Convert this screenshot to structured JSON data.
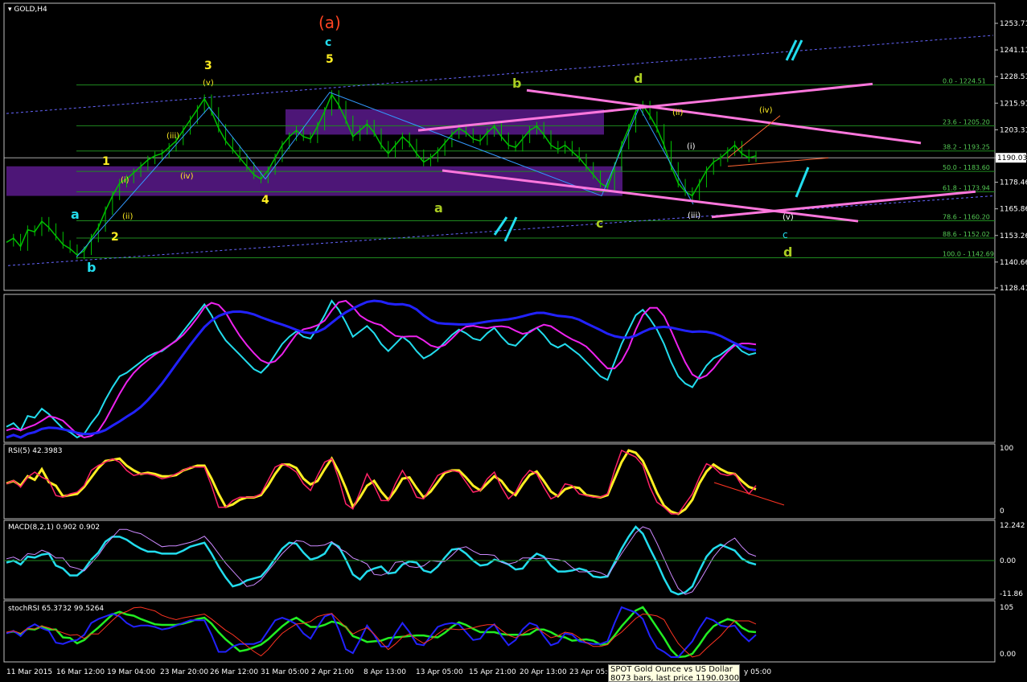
{
  "symbol_label": "GOLD,H4",
  "colors": {
    "background": "#000000",
    "grid_border": "#c0c0c0",
    "fib": "#1f8a1f",
    "candle": "#00c000",
    "zone": "#5a1a8c",
    "pink": "#ff77dd",
    "cyan": "#22ddee",
    "yellow": "#ffee22",
    "orange_red": "#ff4422",
    "blue": "#2222ff",
    "magenta": "#ee22ee"
  },
  "price_axis": {
    "ticks": [
      "1253.71",
      "1241.11",
      "1228.51",
      "1215.91",
      "1203.31",
      "1190.03",
      "1178.46",
      "1165.86",
      "1153.26",
      "1140.66",
      "1128.41"
    ],
    "current_price": "1190.03"
  },
  "chart_data": {
    "type": "line",
    "title": "GOLD,H4",
    "ylim": [
      1128.41,
      1253.71
    ],
    "fib_levels": [
      {
        "label": "0.0 - 1224.51",
        "value": 1224.51
      },
      {
        "label": "23.6 - 1205.20",
        "value": 1205.2
      },
      {
        "label": "38.2 - 1193.25",
        "value": 1193.25
      },
      {
        "label": "50.0 - 1183.60",
        "value": 1183.6
      },
      {
        "label": "61.8 - 1173.94",
        "value": 1173.94
      },
      {
        "label": "78.6 - 1160.20",
        "value": 1160.2
      },
      {
        "label": "88.6 - 1152.02",
        "value": 1152.02
      },
      {
        "label": "100.0 - 1142.69",
        "value": 1142.69
      }
    ],
    "x_ticks": [
      "11 Mar 2015",
      "16 Mar 12:00",
      "19 Mar 04:00",
      "23 Mar 20:00",
      "26 Mar 12:00",
      "31 Mar 05:00",
      "2 Apr 21:00",
      "8 Apr 13:00",
      "13 Apr 05:00",
      "15 Apr 21:00",
      "20 Apr 13:00",
      "23 Apr 05:00",
      "y 05:00"
    ],
    "close_series": [
      1150,
      1152,
      1148,
      1156,
      1155,
      1160,
      1157,
      1153,
      1149,
      1147,
      1144,
      1146,
      1152,
      1157,
      1165,
      1172,
      1178,
      1180,
      1183,
      1186,
      1189,
      1191,
      1192,
      1195,
      1198,
      1203,
      1208,
      1213,
      1218,
      1212,
      1204,
      1198,
      1194,
      1190,
      1186,
      1182,
      1180,
      1184,
      1190,
      1196,
      1200,
      1203,
      1200,
      1199,
      1205,
      1212,
      1220,
      1215,
      1208,
      1200,
      1203,
      1206,
      1202,
      1196,
      1192,
      1196,
      1200,
      1197,
      1192,
      1188,
      1190,
      1193,
      1197,
      1201,
      1204,
      1202,
      1199,
      1198,
      1202,
      1205,
      1200,
      1196,
      1195,
      1199,
      1203,
      1205,
      1201,
      1196,
      1194,
      1196,
      1193,
      1190,
      1186,
      1182,
      1178,
      1176,
      1186,
      1196,
      1204,
      1212,
      1215,
      1210,
      1204,
      1196,
      1186,
      1178,
      1174,
      1172,
      1178,
      1184,
      1188,
      1190,
      1193,
      1196,
      1192,
      1190,
      1191
    ],
    "indicator_labels": {
      "rsi": "RSI(5) 42.3983",
      "macd": "MACD(8,2,1) 0.902 0.902",
      "stoch": "stochRSI 65.3732 99.5264"
    },
    "indicator_axes": {
      "rsi": [
        "100",
        "0"
      ],
      "macd": [
        "12.242",
        "0.00",
        "-11.86"
      ],
      "stoch": [
        "105",
        "0.00"
      ]
    }
  },
  "annotations": {
    "wave_a_paren": "(a)",
    "labels": [
      {
        "text": "c",
        "color": "cyan"
      },
      {
        "text": "5",
        "color": "yellow"
      },
      {
        "text": "3",
        "color": "yellow"
      },
      {
        "text": "(v)",
        "color": "yellow"
      },
      {
        "text": "(iii)",
        "color": "yellow"
      },
      {
        "text": "(iv)",
        "color": "yellow"
      },
      {
        "text": "(i)",
        "color": "yellow"
      },
      {
        "text": "(ii)",
        "color": "yellow"
      },
      {
        "text": "1",
        "color": "yellow"
      },
      {
        "text": "2",
        "color": "yellow"
      },
      {
        "text": "4",
        "color": "yellow"
      },
      {
        "text": "a",
        "color": "cyan"
      },
      {
        "text": "b",
        "color": "cyan"
      },
      {
        "text": "b",
        "color": "green"
      },
      {
        "text": "d",
        "color": "green"
      },
      {
        "text": "a",
        "color": "green"
      },
      {
        "text": "c",
        "color": "green"
      },
      {
        "text": "d",
        "color": "green"
      },
      {
        "text": "c",
        "color": "cyan"
      },
      {
        "text": "(iv)",
        "color": "yellow"
      },
      {
        "text": "(ii)",
        "color": "yellow"
      },
      {
        "text": "(i)",
        "color": "white"
      },
      {
        "text": "(iii)",
        "color": "white"
      },
      {
        "text": "(v)",
        "color": "white"
      }
    ]
  },
  "tooltip": {
    "line1": "SPOT Gold Ounce vs US Dollar",
    "line2": "8073 bars, last price 1190.03000"
  }
}
